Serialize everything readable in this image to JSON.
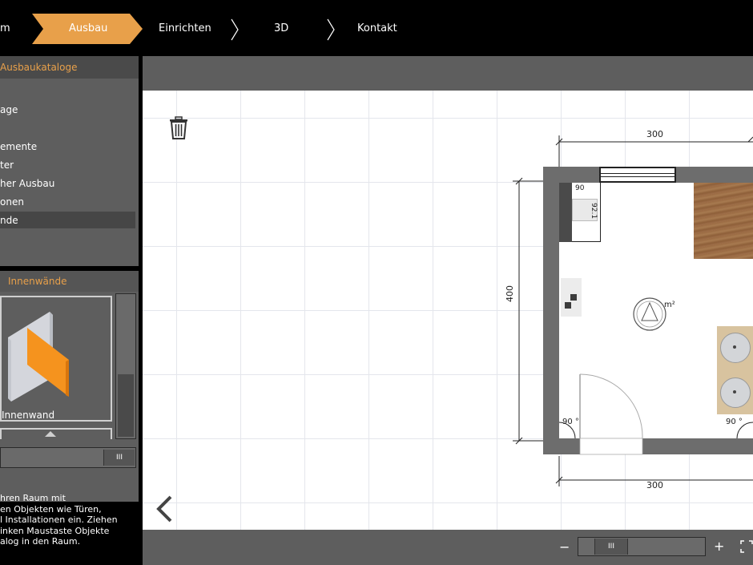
{
  "nav": {
    "items": [
      {
        "label": "m"
      },
      {
        "label": "Ausbau"
      },
      {
        "label": "Einrichten"
      },
      {
        "label": "3D"
      },
      {
        "label": "Kontakt"
      }
    ]
  },
  "catalog": {
    "header": "Ausbaukataloge",
    "items": [
      "age",
      "emente",
      "ter",
      "her Ausbau",
      "onen",
      "nde"
    ],
    "selected_index": 5
  },
  "preview": {
    "header": "Innenwände",
    "item_label": "Innenwand"
  },
  "help_text": [
    "hren Raum mit",
    "en Objekten wie Türen,",
    "l Installationen ein. Ziehen",
    "inken Maustaste Objekte",
    "alog in den Raum."
  ],
  "plan": {
    "dim_top": "300",
    "dim_bottom": "300",
    "dim_left": "400",
    "angle_tl": "90",
    "angle_bl": "90 °",
    "angle_br": "90 °",
    "wc_dim": "92.1",
    "area_label": "m²"
  },
  "toolbar": {
    "zoom_out": "−",
    "zoom_in": "+",
    "slider_handle": "III",
    "left_scroll_handle": "III"
  },
  "colors": {
    "accent": "#e8a04a",
    "panel": "#5e5e5e",
    "wall": "#6d6d6d"
  }
}
